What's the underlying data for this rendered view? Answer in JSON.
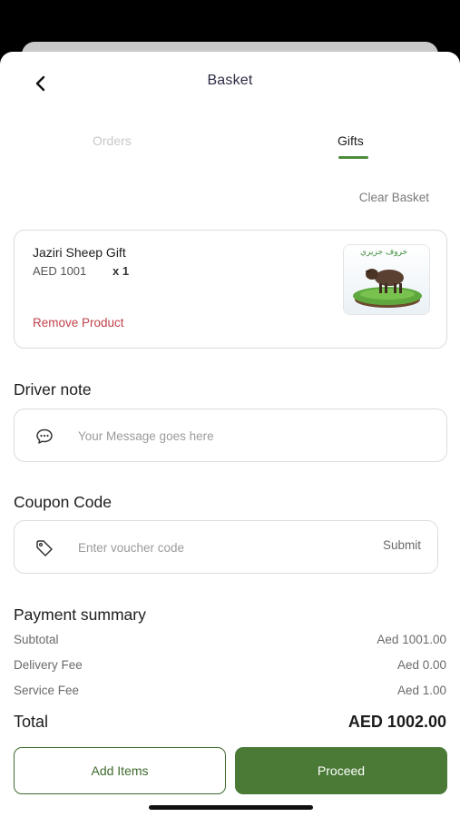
{
  "header": {
    "title": "Basket"
  },
  "tabs": [
    {
      "label": "Orders",
      "active": false
    },
    {
      "label": "Gifts",
      "active": true
    }
  ],
  "accent_color": "#4a7a35",
  "danger_color": "#c0434b",
  "clear_basket_label": "Clear Basket",
  "product": {
    "name": "Jaziri Sheep Gift",
    "price": "AED 1001",
    "quantity": "x 1",
    "remove_label": "Remove Product",
    "image_caption": "خروف جزيري"
  },
  "driver_note": {
    "label": "Driver note",
    "placeholder": "Your Message goes here",
    "icon": "chat-bubble-icon"
  },
  "coupon": {
    "label": "Coupon Code",
    "placeholder": "Enter voucher code",
    "submit_label": "Submit",
    "icon": "tag-icon"
  },
  "payment_summary": {
    "title": "Payment summary",
    "rows": [
      {
        "label": "Subtotal",
        "value": "Aed 1001.00"
      },
      {
        "label": "Delivery Fee",
        "value": "Aed 0.00"
      },
      {
        "label": "Service Fee",
        "value": "Aed 1.00"
      }
    ],
    "total_label": "Total",
    "total_value": "AED 1002.00"
  },
  "actions": {
    "add_items_label": "Add Items",
    "proceed_label": "Proceed"
  }
}
